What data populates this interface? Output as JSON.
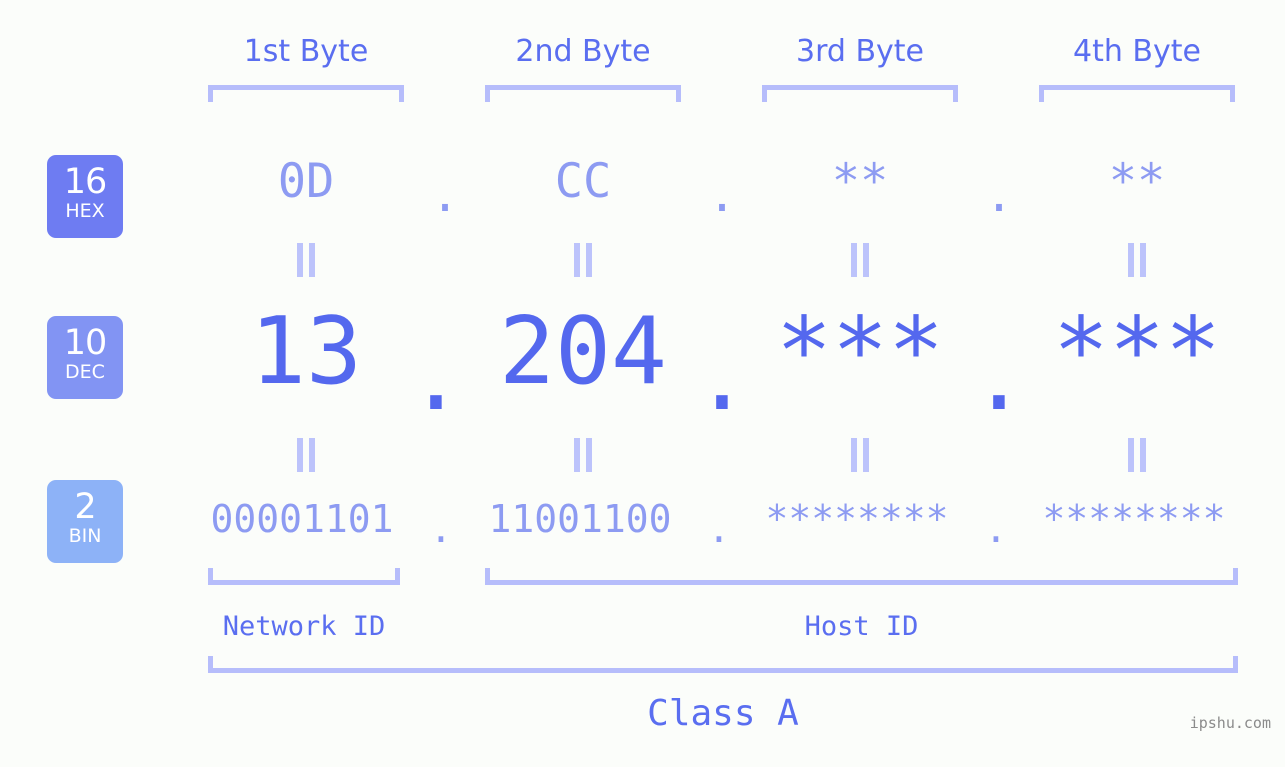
{
  "meta": {
    "background_color": "#fbfdfa",
    "accent_color": "#5468ee",
    "light_accent_color": "#8d9bf2",
    "bracket_color": "#b6bdfb",
    "footer_color": "#8b8b8b"
  },
  "byte_headers": [
    {
      "label": "1st Byte"
    },
    {
      "label": "2nd Byte"
    },
    {
      "label": "3rd Byte"
    },
    {
      "label": "4th Byte"
    }
  ],
  "bases": [
    {
      "radix": "16",
      "name": "HEX",
      "color": "#6e7cf2"
    },
    {
      "radix": "10",
      "name": "DEC",
      "color": "#8294f3"
    },
    {
      "radix": "2",
      "name": "BIN",
      "color": "#8db2f7"
    }
  ],
  "rows": {
    "hex": {
      "base_label": "HEX",
      "radix": "16",
      "values": [
        "0D",
        "CC",
        "**",
        "**"
      ],
      "separator": "."
    },
    "dec": {
      "base_label": "DEC",
      "radix": "10",
      "values": [
        "13",
        "204",
        "***",
        "***"
      ],
      "separator": "."
    },
    "bin": {
      "base_label": "BIN",
      "radix": "2",
      "values": [
        "00001101",
        "11001100",
        "********",
        "********"
      ],
      "separator": "."
    }
  },
  "equals_glyph": "=",
  "regions": {
    "network_id": "Network ID",
    "host_id": "Host ID"
  },
  "class": {
    "label": "Class A"
  },
  "footer": {
    "text": "ipshu.com"
  }
}
